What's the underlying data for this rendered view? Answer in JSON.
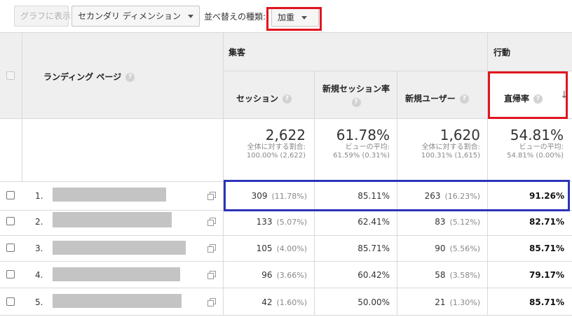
{
  "toolbar": {
    "graph_button": "グラフに表示",
    "secondary_dimension": "セカンダリ ディメンション",
    "sort_type_label": "並べ替えの種類:",
    "sort_type_value": "加重"
  },
  "table": {
    "landing_page_header": "ランディング ページ",
    "groups": {
      "acquisition": "集客",
      "behavior": "行動"
    },
    "columns": {
      "sessions": "セッション",
      "new_session_rate": "新規セッション率",
      "new_users": "新規ユーザー",
      "bounce_rate": "直帰率"
    },
    "totals": {
      "sessions": {
        "value": "2,622",
        "line1": "全体に対する割合:",
        "line2": "100.00% (2,622)"
      },
      "new_session_rate": {
        "value": "61.78%",
        "line1": "ビューの平均:",
        "line2": "61.59% (0.31%)"
      },
      "new_users": {
        "value": "1,620",
        "line1": "全体に対する割合:",
        "line2": "100.31% (1,615)"
      },
      "bounce_rate": {
        "value": "54.81%",
        "line1": "ビューの平均:",
        "line2": "54.81% (0.00%)"
      }
    },
    "rows": [
      {
        "num": "1.",
        "sessions": "309",
        "sessions_pct": "(11.78%)",
        "new_session_rate": "85.11%",
        "new_users": "263",
        "new_users_pct": "(16.23%)",
        "bounce_rate": "91.26%"
      },
      {
        "num": "2.",
        "sessions": "133",
        "sessions_pct": "(5.07%)",
        "new_session_rate": "62.41%",
        "new_users": "83",
        "new_users_pct": "(5.12%)",
        "bounce_rate": "82.71%"
      },
      {
        "num": "3.",
        "sessions": "105",
        "sessions_pct": "(4.00%)",
        "new_session_rate": "85.71%",
        "new_users": "90",
        "new_users_pct": "(5.56%)",
        "bounce_rate": "85.71%"
      },
      {
        "num": "4.",
        "sessions": "96",
        "sessions_pct": "(3.66%)",
        "new_session_rate": "60.42%",
        "new_users": "58",
        "new_users_pct": "(3.58%)",
        "bounce_rate": "79.17%"
      },
      {
        "num": "5.",
        "sessions": "42",
        "sessions_pct": "(1.60%)",
        "new_session_rate": "50.00%",
        "new_users": "21",
        "new_users_pct": "(1.30%)",
        "bounce_rate": "85.71%"
      }
    ]
  },
  "annotation_colors": {
    "highlight_red": "#e0151f",
    "highlight_blue": "#2b34b8"
  }
}
